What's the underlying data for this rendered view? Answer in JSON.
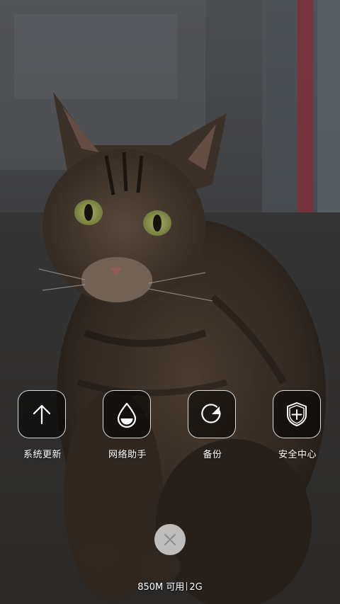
{
  "wallpaper": {
    "subject": "tabby cat photo"
  },
  "quick_actions": [
    {
      "label": "系统更新",
      "icon": "arrow-up-icon"
    },
    {
      "label": "网络助手",
      "icon": "water-drop-icon"
    },
    {
      "label": "备份",
      "icon": "backup-refresh-icon"
    },
    {
      "label": "安全中心",
      "icon": "shield-plus-icon"
    }
  ],
  "close_button": {
    "icon": "close-icon"
  },
  "memory": {
    "available": "850M 可用",
    "total": "2G"
  },
  "colors": {
    "tile_border": "#ffffff",
    "tile_background": "#000000",
    "text": "#ffffff",
    "close_background": "#ebebeb",
    "close_icon": "#8a8a8a"
  }
}
